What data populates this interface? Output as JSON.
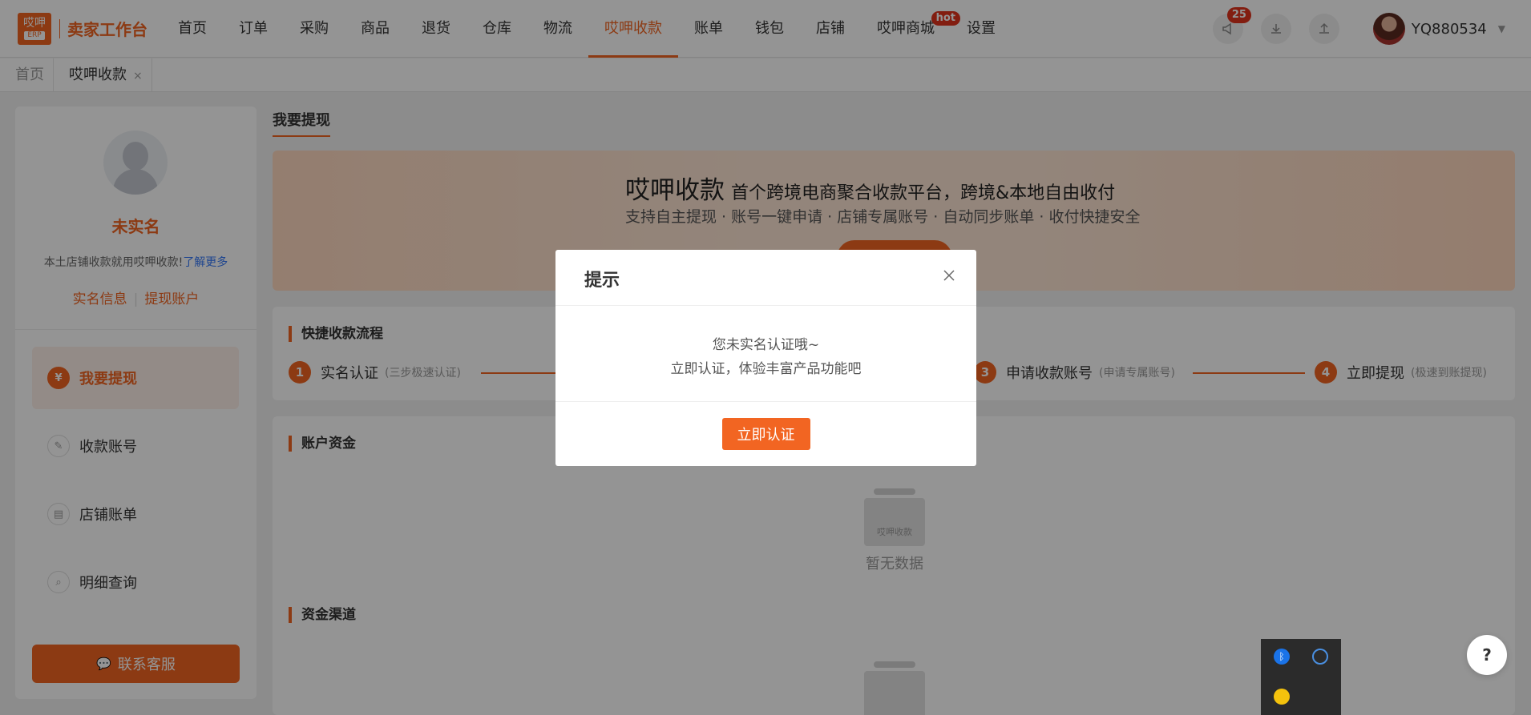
{
  "brand": {
    "logo_top": "哎呷",
    "logo_bottom": "ERP",
    "name": "卖家工作台"
  },
  "nav": {
    "items": [
      "首页",
      "订单",
      "采购",
      "商品",
      "退货",
      "仓库",
      "物流",
      "哎呷收款",
      "账单",
      "钱包",
      "店铺",
      "哎呷商城",
      "设置"
    ],
    "active": "哎呷收款",
    "hot_badge": "hot"
  },
  "header": {
    "notification_count": "25",
    "username": "YQ880534"
  },
  "tabs": [
    {
      "label": "首页",
      "active": false
    },
    {
      "label": "哎呷收款",
      "active": true,
      "close": "×"
    }
  ],
  "sidebar": {
    "status": "未实名",
    "intro": "本土店铺收款就用哎呷收款!",
    "learn_more": "了解更多",
    "link_realname": "实名信息",
    "link_separator": "|",
    "link_account": "提现账户",
    "menu": [
      "我要提现",
      "收款账号",
      "店铺账单",
      "明细查询"
    ],
    "active_menu": "我要提现",
    "service_button": "联系客服"
  },
  "main": {
    "title": "我要提现",
    "banner": {
      "brand": "哎呷收款",
      "headline": "首个跨境电商聚合收款平台，跨境&本地自由收付",
      "subline": "支持自主提现 · 账号一键申请 · 店铺专属账号 · 自动同步账单 · 收付快捷安全"
    },
    "flow": {
      "title": "快捷收款流程",
      "steps": [
        {
          "num": "1",
          "label": "实名认证",
          "hint": "(三步极速认证)"
        },
        {
          "num": "3",
          "label": "申请收款账号",
          "hint": "(申请专属账号)"
        },
        {
          "num": "4",
          "label": "立即提现",
          "hint": "(极速到账提现)"
        }
      ]
    },
    "funds": {
      "title": "账户资金",
      "empty_icon_text": "哎呷收款",
      "empty_text": "暂无数据"
    },
    "channels": {
      "title": "资金渠道"
    }
  },
  "dialog": {
    "title": "提示",
    "line1": "您未实名认证哦~",
    "line2": "立即认证，体验丰富产品功能吧",
    "button": "立即认证"
  },
  "help": {
    "label": "?"
  },
  "colors": {
    "accent": "#f26522",
    "badge": "#e0321d",
    "link": "#3478f6"
  }
}
